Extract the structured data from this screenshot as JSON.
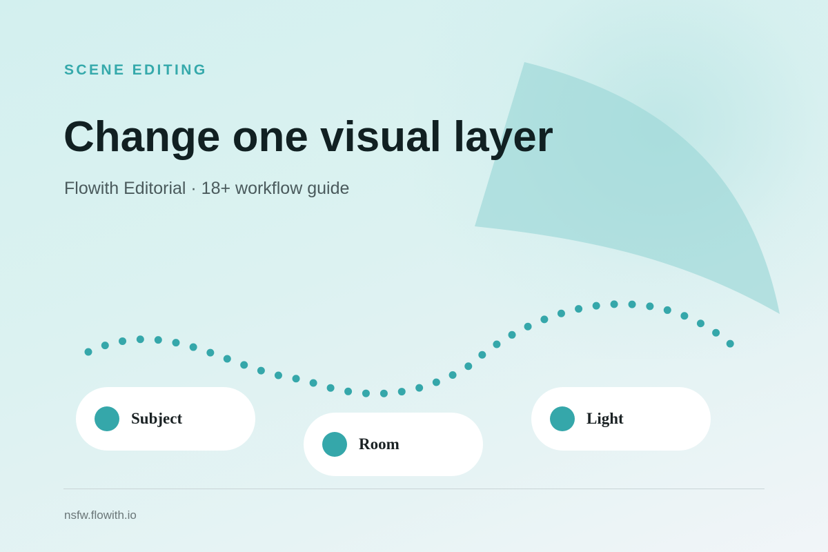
{
  "header": {
    "eyebrow": "SCENE EDITING",
    "title": "Change one visual layer",
    "subtitle": "Flowith Editorial · 18+ workflow guide"
  },
  "chips": [
    {
      "label": "Subject"
    },
    {
      "label": "Room"
    },
    {
      "label": "Light"
    }
  ],
  "footer": {
    "url": "nsfw.flowith.io"
  },
  "colors": {
    "accent": "#35a9ab",
    "title": "#112022",
    "subtitle": "#4a5a5c",
    "chip_background": "#ffffff",
    "wedge": "#9fd8d8"
  }
}
